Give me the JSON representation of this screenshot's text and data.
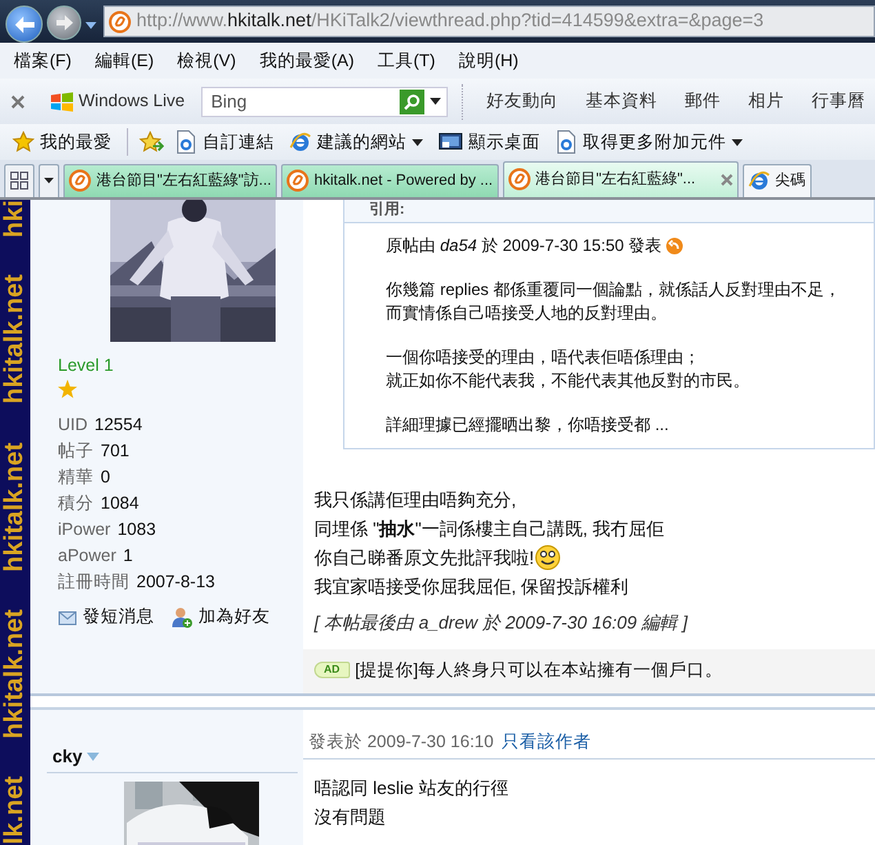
{
  "nav": {
    "address": "http://www.**hkitalk.net**/HKiTalk2/viewthread.php?tid=414599&extra=&page=3"
  },
  "menu": [
    "檔案(F)",
    "編輯(E)",
    "檢視(V)",
    "我的最愛(A)",
    "工具(T)",
    "說明(H)"
  ],
  "live_toolbar": {
    "brand": "Windows Live",
    "search": {
      "placeholder": "Bing"
    },
    "links": [
      "好友動向",
      "基本資料",
      "郵件",
      "相片",
      "行事曆"
    ]
  },
  "favorites_bar": {
    "favorites": "我的最愛",
    "items": [
      {
        "label": "自訂連結",
        "kind": "page",
        "dropdown": false
      },
      {
        "label": "建議的網站",
        "kind": "ie",
        "dropdown": true
      },
      {
        "label": "顯示桌面",
        "kind": "desktop",
        "dropdown": false
      },
      {
        "label": "取得更多附加元件",
        "kind": "page",
        "dropdown": true
      }
    ]
  },
  "tabs": [
    {
      "label": "港台節目\"左右紅藍綠\"訪...",
      "selected": false,
      "kind": "site"
    },
    {
      "label": "hkitalk.net - Powered by ...",
      "selected": false,
      "kind": "site"
    },
    {
      "label": "港台節目\"左右紅藍綠\"...",
      "selected": true,
      "kind": "site"
    },
    {
      "label": "尖碼",
      "selected": false,
      "kind": "ie"
    }
  ],
  "side_banner": [
    "hki",
    "hkitalk.net",
    "hkitalk.net",
    "hkitalk.net",
    "lk.net"
  ],
  "posts": [
    {
      "profile": {
        "level": "Level 1",
        "stats": [
          {
            "label": "UID",
            "value": "12554"
          },
          {
            "label": "帖子",
            "value": "701"
          },
          {
            "label": "精華",
            "value": "0"
          },
          {
            "label": "積分",
            "value": "1084"
          },
          {
            "label": "iPower",
            "value": "1083"
          },
          {
            "label": "aPower",
            "value": "1"
          },
          {
            "label": "註冊時間",
            "value": "2007-8-13"
          }
        ],
        "actions": [
          {
            "label": "發短消息",
            "kind": "message"
          },
          {
            "label": "加為好友",
            "kind": "friend"
          }
        ]
      },
      "quote": {
        "title": "引用:",
        "byline": "原帖由 *da54* 於 2009-7-30 15:50 發表",
        "paragraphs": [
          [
            "你幾篇 replies 都係重覆同一個論點，就係話人反對理由不足，",
            "而實情係自己唔接受人地的反對理由。"
          ],
          [
            "一個你唔接受的理由，唔代表佢唔係理由；",
            "就正如你不能代表我，不能代表其他反對的市民。"
          ],
          [
            "詳細理據已經擺晒出黎，你唔接受都 ..."
          ]
        ]
      },
      "lines": [
        {
          "text": "我只係講佢理由唔夠充分,",
          "smiley": false
        },
        {
          "text": "同埋係 \"**抽水**\"一詞係樓主自己講既, 我冇屈佢",
          "smiley": false
        },
        {
          "text": "你自己睇番原文先批評我啦!",
          "smiley": true
        },
        {
          "text": "我宜家唔接受你屈我屈佢, 保留投訴權利",
          "smiley": false
        }
      ],
      "edit_note": "[ 本帖最後由 a_drew 於 2009-7-30 16:09 編輯 ]",
      "ad": {
        "badge": "AD",
        "text": "[提提你]每人終身只可以在本站擁有一個戶口。"
      }
    },
    {
      "author": "cky",
      "posted": "發表於 2009-7-30 16:10",
      "author_only": "只看該作者",
      "lines": [
        {
          "text": "唔認同 leslie 站友的行徑",
          "smiley": false
        },
        {
          "text": "沒有問題",
          "smiley": false
        }
      ]
    }
  ]
}
